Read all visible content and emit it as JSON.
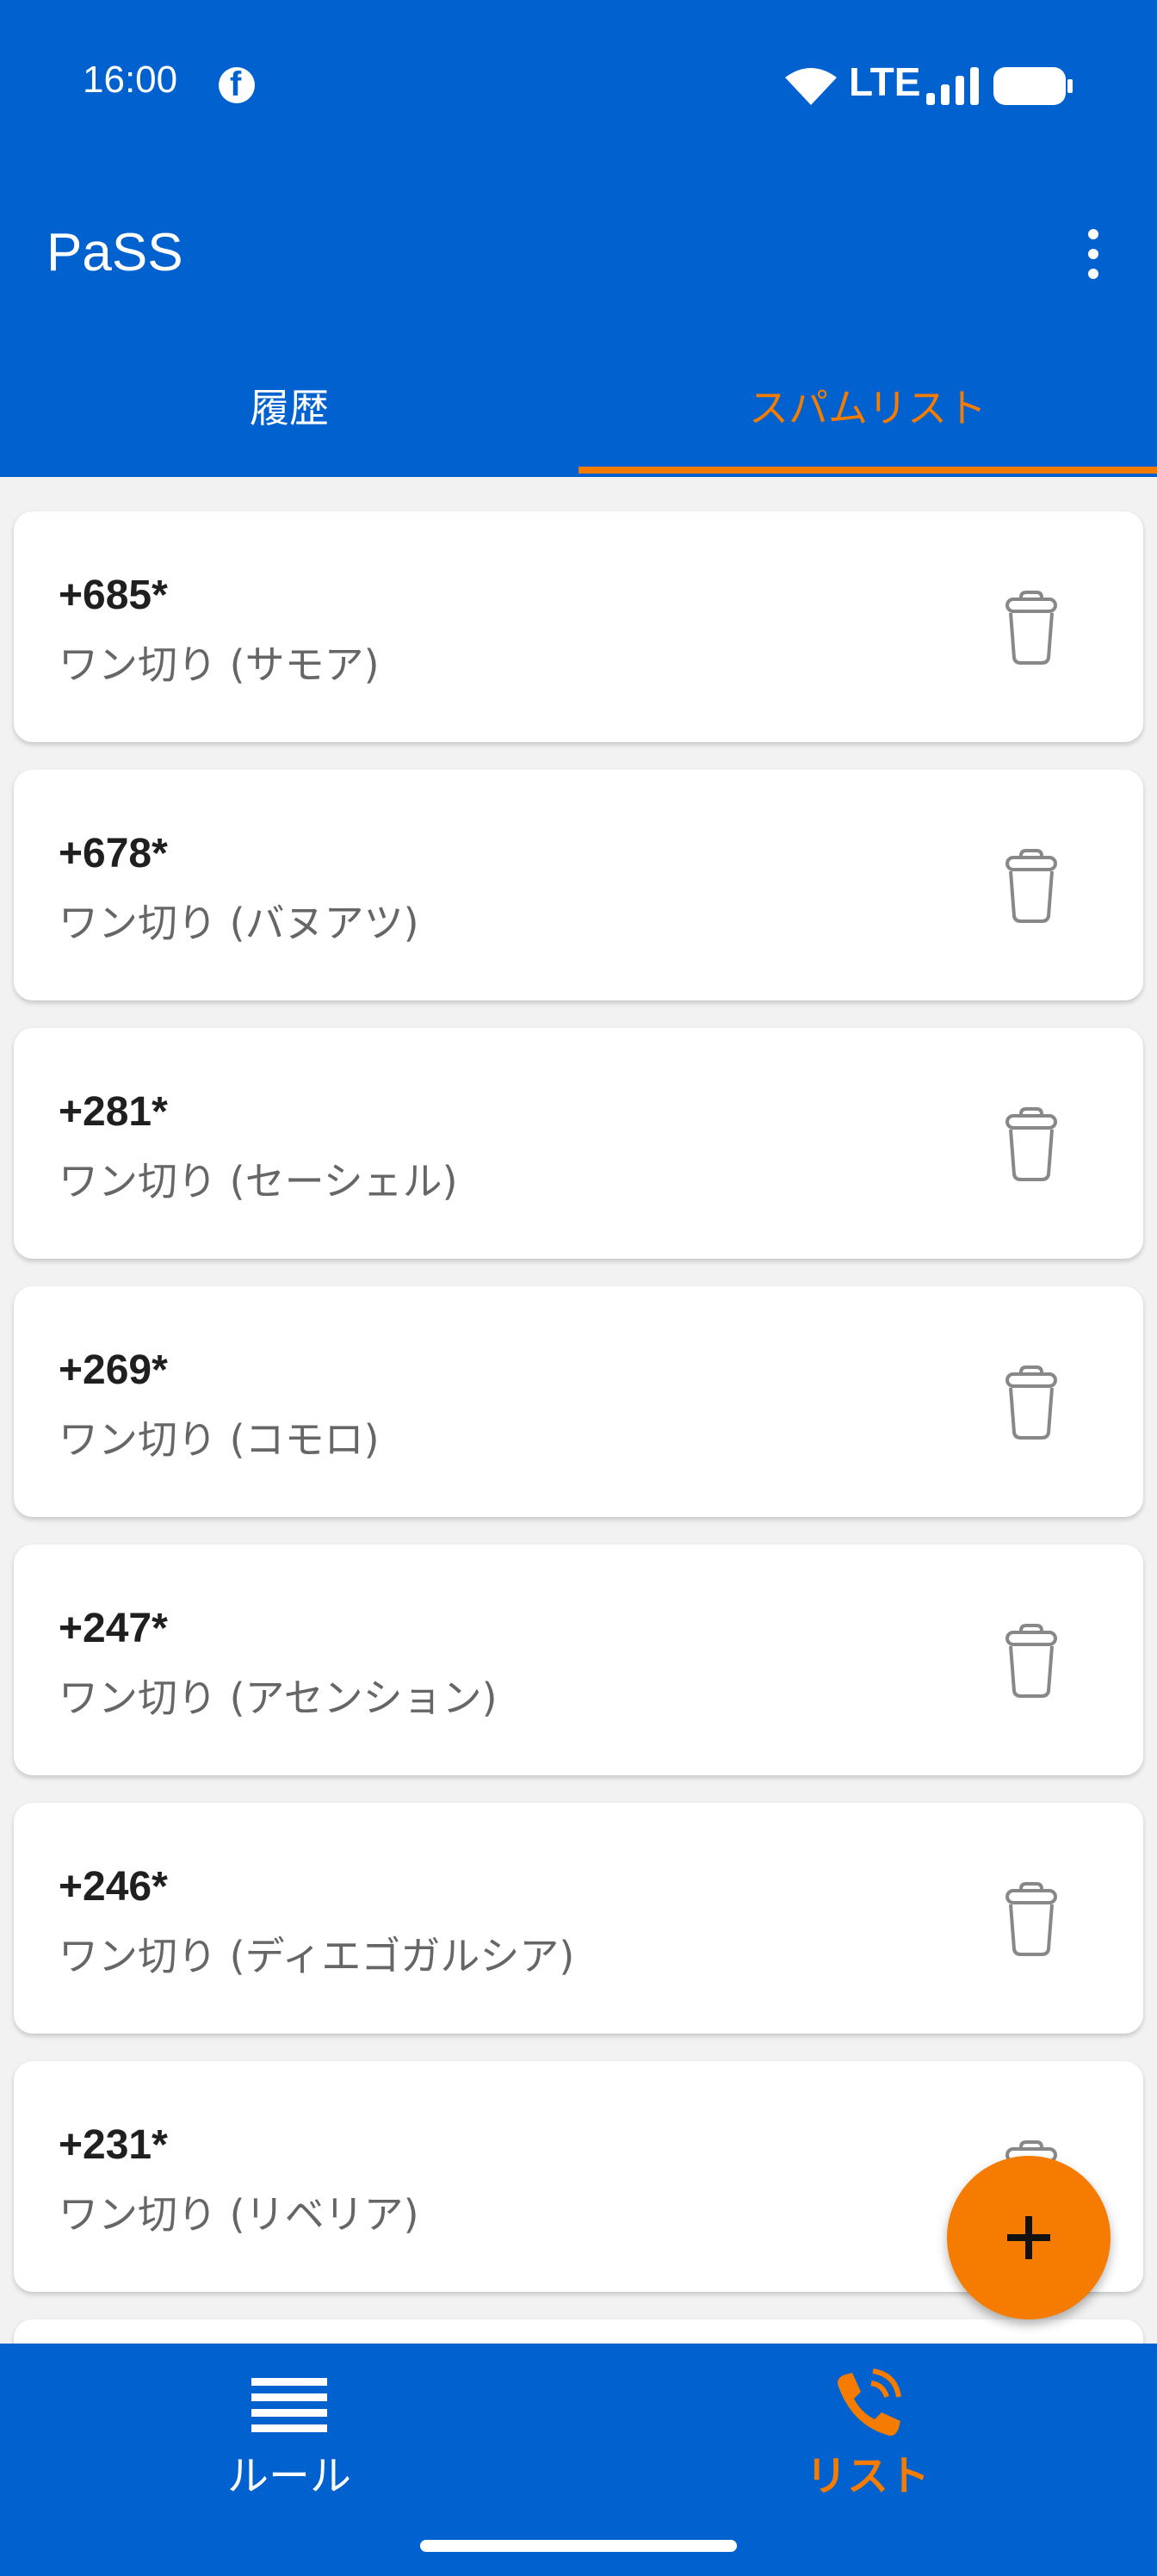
{
  "status_bar": {
    "time": "16:00",
    "network": "LTE"
  },
  "app": {
    "title": "PaSS"
  },
  "tabs": [
    {
      "label": "履歴",
      "active": false
    },
    {
      "label": "スパムリスト",
      "active": true
    }
  ],
  "spam_list": [
    {
      "number": "+685*",
      "description": "ワン切り (サモア)"
    },
    {
      "number": "+678*",
      "description": "ワン切り (バヌアツ)"
    },
    {
      "number": "+281*",
      "description": "ワン切り (セーシェル)"
    },
    {
      "number": "+269*",
      "description": "ワン切り (コモロ)"
    },
    {
      "number": "+247*",
      "description": "ワン切り (アセンション)"
    },
    {
      "number": "+246*",
      "description": "ワン切り (ディエゴガルシア)"
    },
    {
      "number": "+231*",
      "description": "ワン切り (リベリア)"
    }
  ],
  "bottom_nav": [
    {
      "label": "ルール",
      "icon": "menu-lines-icon",
      "active": false
    },
    {
      "label": "リスト",
      "icon": "phone-ringing-icon",
      "active": true
    }
  ],
  "colors": {
    "primary": "#0061cf",
    "accent": "#f57c00"
  }
}
